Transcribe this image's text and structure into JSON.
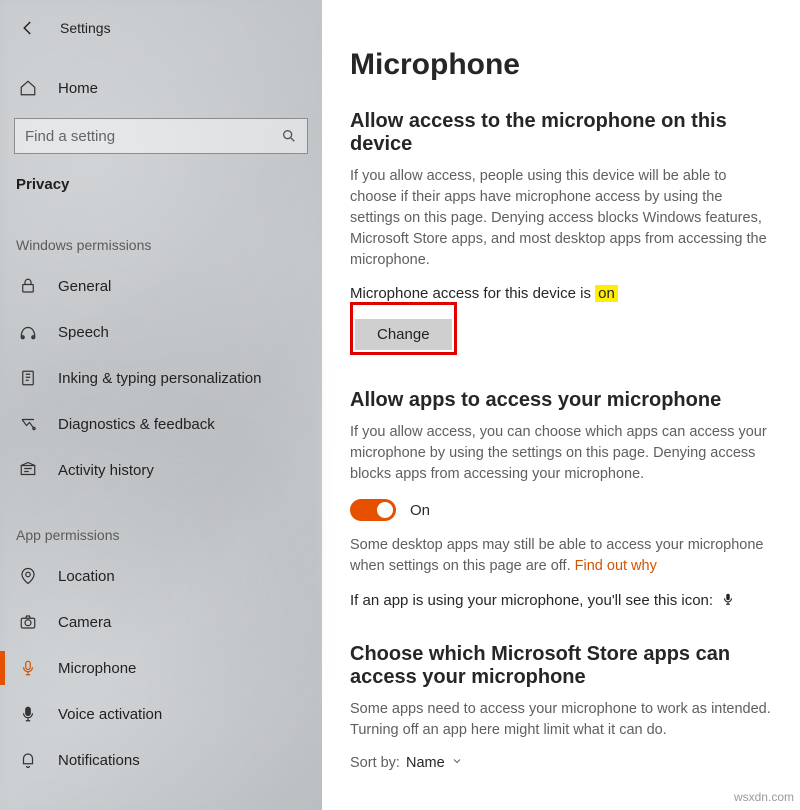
{
  "header": {
    "app_title": "Settings",
    "home_label": "Home",
    "search_placeholder": "Find a setting",
    "category_label": "Privacy"
  },
  "sidebar": {
    "section1_label": "Windows permissions",
    "items1": [
      {
        "label": "General",
        "icon": "lock-icon"
      },
      {
        "label": "Speech",
        "icon": "speech-icon"
      },
      {
        "label": "Inking & typing personalization",
        "icon": "inking-icon"
      },
      {
        "label": "Diagnostics & feedback",
        "icon": "diagnostics-icon"
      },
      {
        "label": "Activity history",
        "icon": "history-icon"
      }
    ],
    "section2_label": "App permissions",
    "items2": [
      {
        "label": "Location",
        "icon": "location-icon",
        "active": false
      },
      {
        "label": "Camera",
        "icon": "camera-icon",
        "active": false
      },
      {
        "label": "Microphone",
        "icon": "microphone-icon",
        "active": true
      },
      {
        "label": "Voice activation",
        "icon": "voice-icon",
        "active": false
      },
      {
        "label": "Notifications",
        "icon": "notification-icon",
        "active": false
      }
    ]
  },
  "main": {
    "page_title": "Microphone",
    "s1": {
      "title": "Allow access to the microphone on this device",
      "desc": "If you allow access, people using this device will be able to choose if their apps have microphone access by using the settings on this page. Denying access blocks Windows features, Microsoft Store apps, and most desktop apps from accessing the microphone.",
      "status_prefix": "Microphone access for this device is ",
      "status_value": "on",
      "change_label": "Change"
    },
    "s2": {
      "title": "Allow apps to access your microphone",
      "desc": "If you allow access, you can choose which apps can access your microphone by using the settings on this page. Denying access blocks apps from accessing your microphone.",
      "toggle_state": "On",
      "note_prefix": "Some desktop apps may still be able to access your microphone when settings on this page are off. ",
      "note_link": "Find out why",
      "usage_line": "If an app is using your microphone, you'll see this icon:"
    },
    "s3": {
      "title": "Choose which Microsoft Store apps can access your microphone",
      "desc": "Some apps need to access your microphone to work as intended. Turning off an app here might limit what it can do.",
      "sort_label": "Sort by:",
      "sort_value": "Name"
    }
  },
  "watermark": "wsxdn.com"
}
